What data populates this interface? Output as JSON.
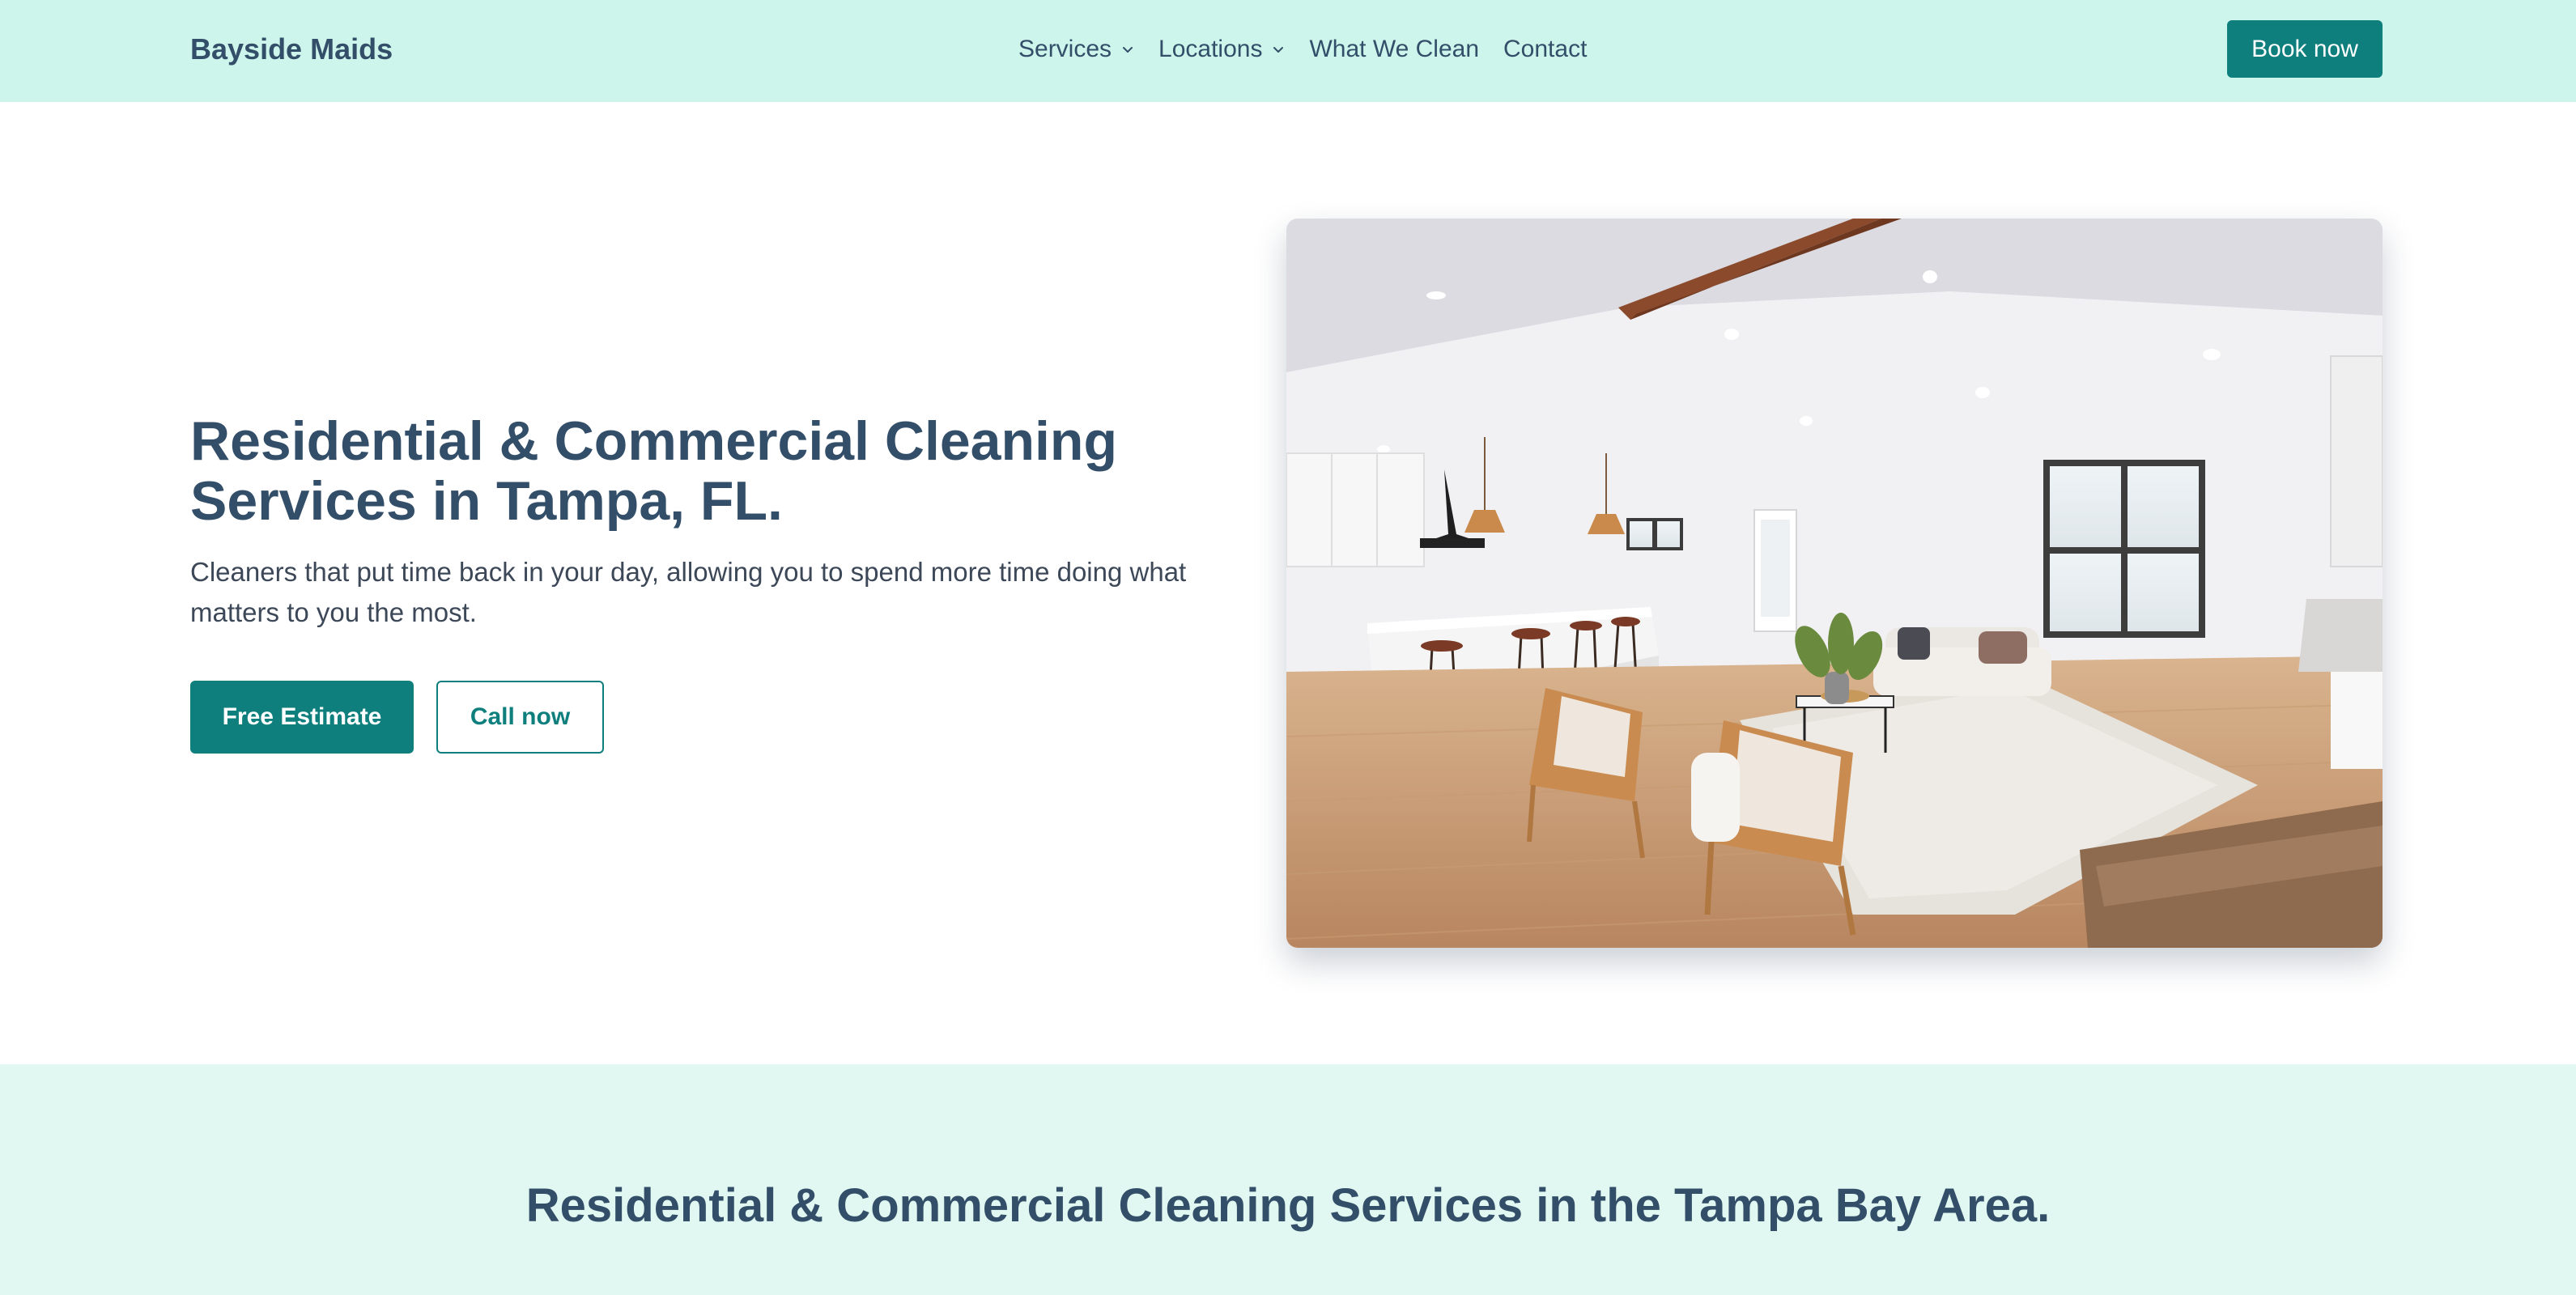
{
  "header": {
    "brand": "Bayside Maids",
    "nav": [
      {
        "label": "Services",
        "has_dropdown": true
      },
      {
        "label": "Locations",
        "has_dropdown": true
      },
      {
        "label": "What We Clean",
        "has_dropdown": false
      },
      {
        "label": "Contact",
        "has_dropdown": false
      }
    ],
    "book_label": "Book now"
  },
  "hero": {
    "title": "Residential & Commercial Cleaning Services in Tampa, FL.",
    "subtitle": "Cleaners that put time back in your day, allowing you to spend more time doing what matters to you the most.",
    "primary_cta": "Free Estimate",
    "secondary_cta": "Call now",
    "image_icon": "living-room-photo"
  },
  "section": {
    "title": "Residential & Commercial Cleaning Services in the Tampa Bay Area."
  },
  "colors": {
    "header_bg": "#cdf5eb",
    "band_bg": "#e1f7f1",
    "primary": "#0f7f7d",
    "text_dark": "#334e68"
  }
}
